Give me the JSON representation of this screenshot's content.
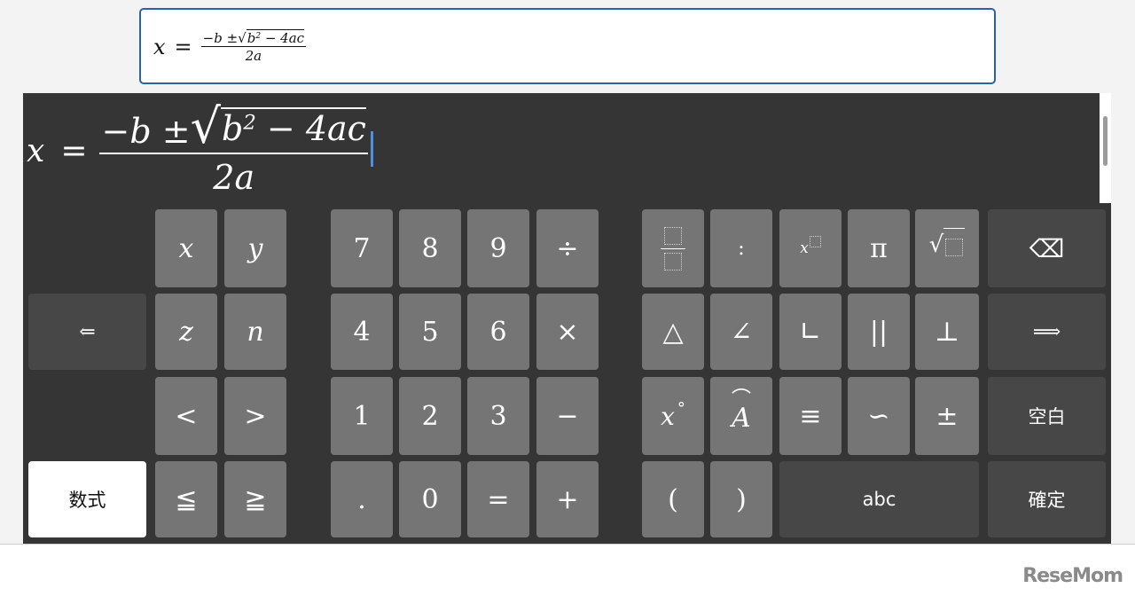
{
  "formula": {
    "lhs": "x",
    "eq": "=",
    "num_pre": "−b ±",
    "num_rad_base": "b",
    "num_rad_exp": "2",
    "num_rad_post": " − 4ac",
    "den": "2a",
    "radical": "√"
  },
  "keys": {
    "x": "x",
    "y": "y",
    "z": "z",
    "n": "n",
    "lt": "<",
    "gt": ">",
    "le": "≦",
    "ge": "≧",
    "k7": "7",
    "k8": "8",
    "k9": "9",
    "div": "÷",
    "k4": "4",
    "k5": "5",
    "k6": "6",
    "mul": "×",
    "k1": "1",
    "k2": "2",
    "k3": "3",
    "minus": "−",
    "dot": ".",
    "k0": "0",
    "equals": "=",
    "plus": "+",
    "colon": ":",
    "pi": "π",
    "power_base": "x",
    "sqrt_sign": "√",
    "backspace": "⌫",
    "triangle": "△",
    "angle": "∠",
    "right_angle": "∟",
    "parallel": "||",
    "perp": "⊥",
    "degree_base": "x",
    "degree": "°",
    "arc_base": "A",
    "arc": "⌒",
    "congruent": "≡",
    "similar": "∽",
    "plusminus": "±",
    "lparen": "(",
    "rparen": ")",
    "left_arrow": "⇐",
    "right_arrow": "⟹",
    "space": "空白",
    "abc": "abc",
    "confirm": "確定",
    "formula_mode": "数式"
  },
  "logo": "ReseMom"
}
